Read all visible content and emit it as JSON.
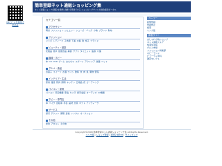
{
  "header": {
    "title": "簡単登録ネット通販ショッピング集",
    "subtitle": "ネット通販ショップ(通販)を簡単に無料で登録できる ショッピングサイトの総合検索ポータル"
  },
  "qr": {
    "caption": "QRコードを携帯で読込み"
  },
  "content": {
    "title": "カテゴリ一覧",
    "categories": [
      {
        "name": "アクセサリー",
        "links": [
          "時計",
          "ファッション",
          "ジュエリー",
          "シューズ・バッグ",
          "小物",
          "ブランド",
          "財布"
        ]
      },
      {
        "name": "ファッション",
        "links": [
          "メンズ",
          "レディース",
          "子供服",
          "下着",
          "水着",
          "靴",
          "帽子",
          "ブランド"
        ]
      },
      {
        "name": "ビューティ・健康",
        "links": [
          "化粧品",
          "香水",
          "健康食品",
          "美容",
          "サプリ",
          "ダイエット",
          "医療",
          "介護"
        ]
      },
      {
        "name": "趣味・ホビー",
        "links": [
          "本",
          "CD",
          "DVD",
          "ゲーム",
          "おもちゃ",
          "スポーツ",
          "アウトドア",
          "楽器",
          "ペット"
        ]
      },
      {
        "name": "グルメ・食品",
        "links": [
          "お菓子",
          "スイーツ",
          "お酒",
          "ワイン",
          "飲料",
          "米",
          "肉",
          "魚",
          "果物",
          "野菜"
        ]
      },
      {
        "name": "インテリア・生活",
        "links": [
          "家具",
          "雑貨",
          "寝具",
          "照明",
          "キッチン",
          "日用品",
          "花",
          "ガーデニング"
        ]
      },
      {
        "name": "パソコン・家電",
        "links": [
          "パソコン",
          "周辺機器",
          "家電",
          "カメラ",
          "携帯電話",
          "オーディオ",
          "AV機器"
        ]
      },
      {
        "name": "ホビー・専門店",
        "links": [
          "車",
          "バイク",
          "自転車",
          "手芸",
          "画材",
          "文具",
          "ギフト",
          "アンティーク"
        ]
      },
      {
        "name": "サービス",
        "links": [
          "旅行",
          "チケット",
          "保険",
          "資格",
          "レンタル",
          "オークション"
        ]
      },
      {
        "name": "その他",
        "links": [
          "総合",
          "アダルト",
          "その他"
        ]
      }
    ]
  },
  "sidebar": {
    "menu_title": "メニュー",
    "menu_items": [
      "新規登録",
      "登録修正",
      "検索",
      "リンク集"
    ],
    "info_title": "新着サイト",
    "info_items": [
      "おしゃれ小物ショップ",
      "ネット通販ストア",
      "快適生活館",
      "グルメ市場",
      "ファッション倶楽部",
      "ホビーランド",
      "ビューティ専科",
      "雑貨セレクト"
    ]
  },
  "footer": {
    "copyright": "Copyright©2008 簡単登録ネット通販ショッピング集 All Rights Reserved.",
    "links": [
      "リンク集",
      "ショップ登録",
      "お問い合わせ",
      "サイトマップ"
    ]
  }
}
